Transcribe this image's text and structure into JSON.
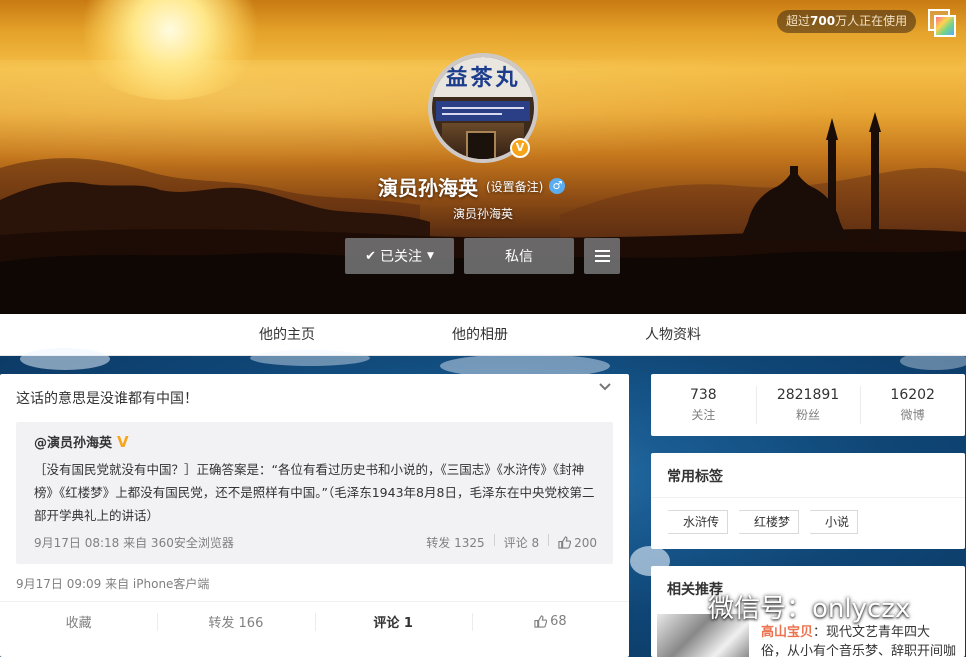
{
  "header": {
    "user_count_badge": {
      "prefix": "超过",
      "count": "700",
      "suffix": "万人正在使用"
    },
    "avatar_sign_text": "益茶丸",
    "verified_mark": "V",
    "name": "演员孙海英",
    "remark_link": "(设置备注)",
    "gender_icon": "male-icon",
    "subname": "演员孙海英",
    "follow_button": {
      "check": "✔",
      "label": "已关注",
      "caret": "▼"
    },
    "message_button": "私信",
    "colors": {
      "button_bg": "#707070",
      "verified": "#f7a61c",
      "male": "#5aaef0"
    }
  },
  "nav": {
    "tabs": [
      {
        "label": "他的主页"
      },
      {
        "label": "他的相册"
      },
      {
        "label": "人物资料"
      }
    ]
  },
  "post": {
    "text": "这话的意思是没谁都有中国！",
    "quote": {
      "user": "@演员孙海英",
      "verified_mark": "V",
      "body": "［没有国民党就没有中国？］正确答案是：“各位有看过历史书和小说的，《三国志》《水浒传》《封神榜》《红楼梦》上都没有国民党，还不是照样有中国。”（毛泽东1943年8月8日，毛泽东在中央党校第二部开学典礼上的讲话）",
      "meta": "9月17日 08:18 来自 360安全浏览器",
      "repost": "转发 1325",
      "comment": "评论 8",
      "likes": "200"
    },
    "meta": "9月17日 09:09 来自 iPhone客户端",
    "actions": {
      "favorite": "收藏",
      "repost": "转发 166",
      "comment": "评论 1",
      "likes": "68"
    },
    "colors": {
      "active_tab": "#fa7d3c"
    }
  },
  "sidebar": {
    "stats": [
      {
        "value": "738",
        "label": "关注"
      },
      {
        "value": "2821891",
        "label": "粉丝"
      },
      {
        "value": "16202",
        "label": "微博"
      }
    ],
    "tags": {
      "title": "常用标签",
      "items": [
        "水浒传",
        "红楼梦",
        "小说"
      ]
    },
    "recommend": {
      "title": "相关推荐",
      "user": "高山宝贝",
      "line1": "：现代文艺青年四大",
      "line2": "俗，从小有个音乐梦、辞职开间咖"
    }
  },
  "watermark": "微信号：onlyczx"
}
